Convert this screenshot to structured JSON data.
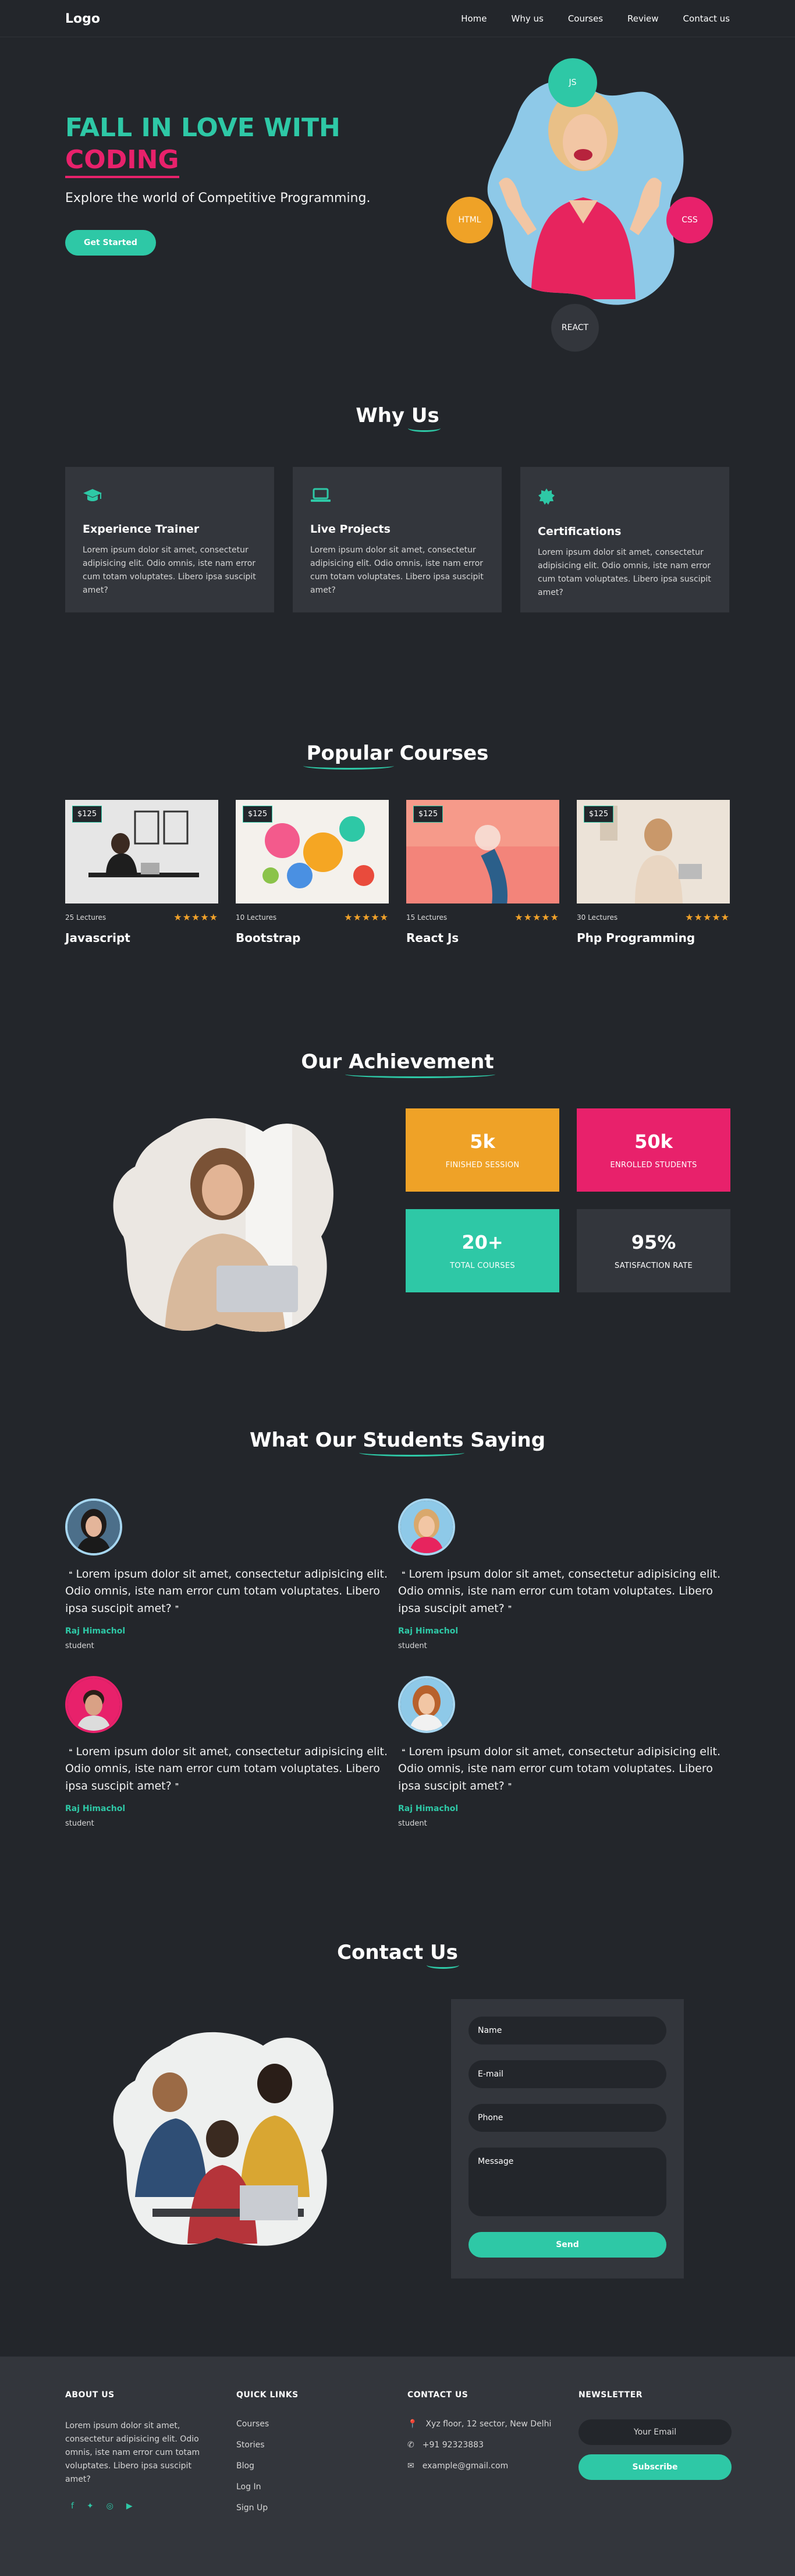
{
  "nav": {
    "logo": "Logo",
    "items": [
      "Home",
      "Why us",
      "Courses",
      "Review",
      "Contact us"
    ]
  },
  "hero": {
    "title_line1": "Fall in love with",
    "title_line2": "Coding",
    "subtitle": "Explore the world of Competitive Programming.",
    "cta": "Get Started",
    "tech": [
      "JS",
      "HTML",
      "CSS",
      "REACT"
    ]
  },
  "why": {
    "title_a": "Why",
    "title_b": "Us",
    "cards": [
      {
        "icon": "graduation-cap-icon",
        "title": "Experience Trainer",
        "text": "Lorem ipsum dolor sit amet, consectetur adipisicing elit. Odio omnis, iste nam error cum totam voluptates. Libero ipsa suscipit amet?"
      },
      {
        "icon": "laptop-icon",
        "title": "Live Projects",
        "text": "Lorem ipsum dolor sit amet, consectetur adipisicing elit. Odio omnis, iste nam error cum totam voluptates. Libero ipsa suscipit amet?"
      },
      {
        "icon": "certificate-icon",
        "title": "Certifications",
        "text": "Lorem ipsum dolor sit amet, consectetur adipisicing elit. Odio omnis, iste nam error cum totam voluptates. Libero ipsa suscipit amet?"
      }
    ]
  },
  "courses": {
    "title_a": "Popular",
    "title_b": "Courses",
    "items": [
      {
        "price": "$125",
        "lectures": "25 Lectures",
        "name": "Javascript",
        "stars": "★★★★★"
      },
      {
        "price": "$125",
        "lectures": "10 Lectures",
        "name": "Bootstrap",
        "stars": "★★★★★"
      },
      {
        "price": "$125",
        "lectures": "15 Lectures",
        "name": "React Js",
        "stars": "★★★★★"
      },
      {
        "price": "$125",
        "lectures": "30 Lectures",
        "name": "Php Programming",
        "stars": "★★★★★"
      }
    ]
  },
  "achievement": {
    "title_a": "Our",
    "title_b": "Achievement",
    "stats": [
      {
        "value": "5k",
        "label": "Finished Session",
        "color": "#efa227"
      },
      {
        "value": "50k",
        "label": "Enrolled Students",
        "color": "#e8216b"
      },
      {
        "value": "20+",
        "label": "Total Courses",
        "color": "#2ec8a6"
      },
      {
        "value": "95%",
        "label": "Satisfaction Rate",
        "color": "#33363c"
      }
    ]
  },
  "testimonials": {
    "title_a": "What Our",
    "title_b": "Students",
    "title_c": "Saying",
    "items": [
      {
        "text": "Lorem ipsum dolor sit amet, consectetur adipisicing elit. Odio omnis, iste nam error cum totam voluptates. Libero ipsa suscipit amet?",
        "name": "Raj Himachol",
        "role": "student",
        "ring": "#a6d6f0"
      },
      {
        "text": "Lorem ipsum dolor sit amet, consectetur adipisicing elit. Odio omnis, iste nam error cum totam voluptates. Libero ipsa suscipit amet?",
        "name": "Raj Himachol",
        "role": "student",
        "ring": "#a6d6f0"
      },
      {
        "text": "Lorem ipsum dolor sit amet, consectetur adipisicing elit. Odio omnis, iste nam error cum totam voluptates. Libero ipsa suscipit amet?",
        "name": "Raj Himachol",
        "role": "student",
        "ring": "#e8216b"
      },
      {
        "text": "Lorem ipsum dolor sit amet, consectetur adipisicing elit. Odio omnis, iste nam error cum totam voluptates. Libero ipsa suscipit amet?",
        "name": "Raj Himachol",
        "role": "student",
        "ring": "#a6d6f0"
      }
    ]
  },
  "contact": {
    "title_a": "Contact",
    "title_b": "Us",
    "name_ph": "Name",
    "email_ph": "E-mail",
    "phone_ph": "Phone",
    "message_ph": "Message",
    "send": "Send"
  },
  "footer": {
    "about_title": "ABOUT US",
    "about_text": "Lorem ipsum dolor sit amet, consectetur adipisicing elit. Odio omnis, iste nam error cum totam voluptates. Libero ipsa suscipit amet?",
    "links_title": "QUICK LINKS",
    "links": [
      "Courses",
      "Stories",
      "Blog",
      "Log In",
      "Sign Up"
    ],
    "contact_title": "CONTACT US",
    "address": "Xyz floor, 12 sector, New Delhi",
    "phone": "+91 92323883",
    "email": "example@gmail.com",
    "news_title": "NEWSLETTER",
    "email_ph": "Your Email",
    "subscribe": "Subscribe"
  },
  "colors": {
    "accent": "#2ec8a6",
    "pink": "#e8216b",
    "orange": "#efa227",
    "bg": "#23262b",
    "card": "#33363c"
  }
}
